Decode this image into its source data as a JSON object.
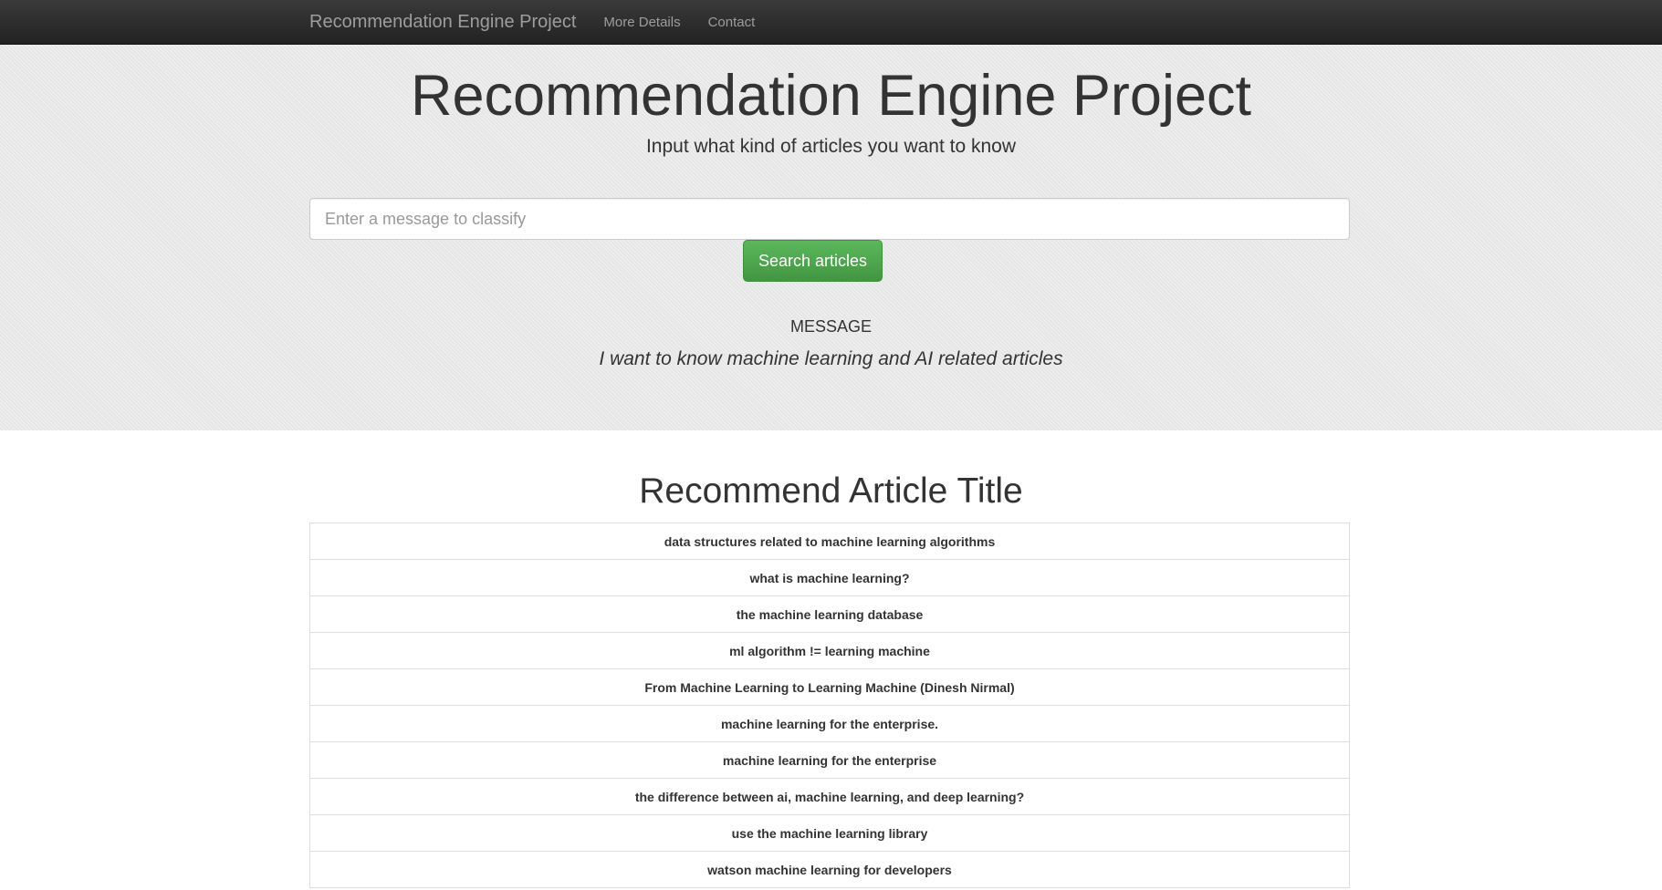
{
  "navbar": {
    "brand": "Recommendation Engine Project",
    "links": [
      "More Details",
      "Contact"
    ]
  },
  "header": {
    "title": "Recommendation Engine Project",
    "subtitle": "Input what kind of articles you want to know"
  },
  "search": {
    "placeholder": "Enter a message to classify",
    "value": "",
    "button_label": "Search articles"
  },
  "message": {
    "label": "MESSAGE",
    "text": "I want to know machine learning and AI related articles"
  },
  "results": {
    "title": "Recommend Article Title",
    "articles": [
      "data structures related to machine learning algorithms",
      "what is machine learning?",
      "the machine learning database",
      "ml algorithm != learning machine",
      "From Machine Learning to Learning Machine (Dinesh Nirmal)",
      "machine learning for the enterprise.",
      "machine learning for the enterprise",
      "the difference between ai, machine learning, and deep learning?",
      "use the machine learning library",
      "watson machine learning for developers"
    ]
  },
  "colors": {
    "navbar": "#222222",
    "jumbotron": "#ebebeb",
    "button": "#5cb85c"
  }
}
